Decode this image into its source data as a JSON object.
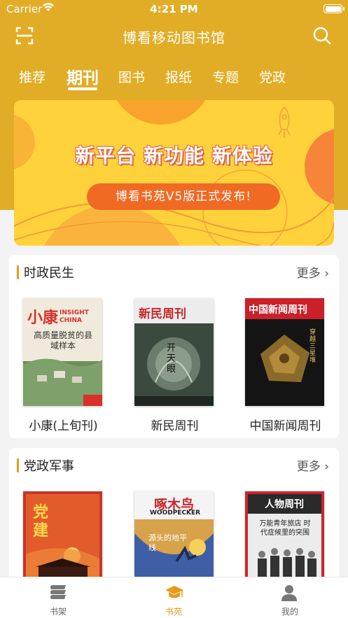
{
  "status_bar": {
    "carrier": "Carrier",
    "time": "4:21 PM"
  },
  "nav": {
    "title": "博看移动图书馆",
    "left_icon": "scan-icon",
    "right_icon": "search-icon"
  },
  "tabs": [
    {
      "label": "推荐",
      "active": false
    },
    {
      "label": "期刊",
      "active": true
    },
    {
      "label": "图书",
      "active": false
    },
    {
      "label": "报纸",
      "active": false
    },
    {
      "label": "专题",
      "active": false
    },
    {
      "label": "党政",
      "active": false
    }
  ],
  "banner": {
    "headline": "新平台 新功能 新体验",
    "subline": "博看书苑V5版正式发布!"
  },
  "sections": [
    {
      "title": "时政民生",
      "more": "更多",
      "books": [
        {
          "title": "小康(上旬刊)",
          "cover_text": "小康",
          "cover_sub": "高质量脱贫的县域样本",
          "cover_en": "INSIGHT CHINA"
        },
        {
          "title": "新民周刊",
          "cover_text": "新民周刊",
          "cover_sub": "开天眼"
        },
        {
          "title": "中国新闻周刊",
          "cover_text": "中国新闻周刊",
          "cover_sub": "穿越三星堆"
        }
      ]
    },
    {
      "title": "党政军事",
      "more": "更多",
      "books": [
        {
          "title": "党建",
          "cover_text": "党建"
        },
        {
          "title": "啄木鸟",
          "cover_text": "啄木鸟",
          "cover_en": "WOODPECKER",
          "cover_sub": "源头的地平线"
        },
        {
          "title": "人物周刊",
          "cover_text": "人物周刊",
          "cover_sub": "万能青年旅店 时代症候里的突围"
        }
      ]
    }
  ],
  "bottom_nav": [
    {
      "label": "书架",
      "icon": "bookshelf-icon",
      "active": false
    },
    {
      "label": "书苑",
      "icon": "graduation-cap-icon",
      "active": true
    },
    {
      "label": "我的",
      "icon": "user-icon",
      "active": false
    }
  ],
  "colors": {
    "brand": "#e2ad26",
    "accent": "#e79a1a",
    "pill": "#f06a23"
  }
}
